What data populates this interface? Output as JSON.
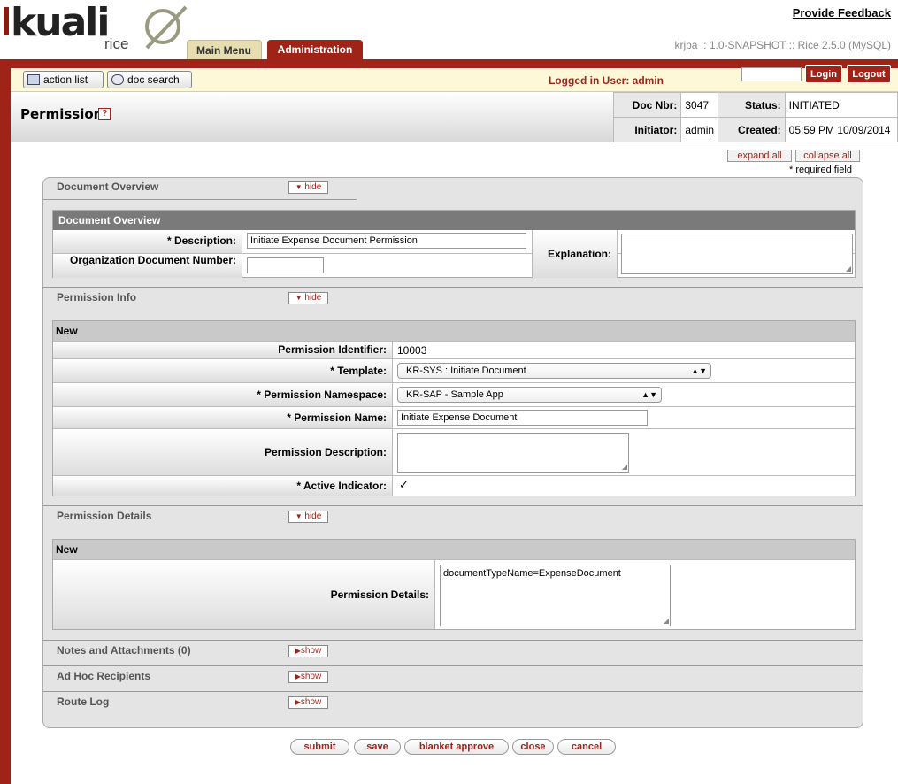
{
  "header": {
    "logo_text": "kuali",
    "logo_sub": "rice",
    "feedback_link": "Provide Feedback",
    "version": "krjpa :: 1.0-SNAPSHOT :: Rice 2.5.0 (MySQL)",
    "tabs": [
      {
        "label": "Main Menu"
      },
      {
        "label": "Administration"
      }
    ]
  },
  "utility": {
    "action_list": "action list",
    "doc_search": "doc search",
    "logged_in": "Logged in User: admin",
    "login_value": "",
    "login_label": "Login",
    "logout_label": "Logout"
  },
  "doc": {
    "title": "Permission",
    "help": "?",
    "doc_nbr_label": "Doc Nbr:",
    "doc_nbr": "3047",
    "status_label": "Status:",
    "status": "INITIATED",
    "initiator_label": "Initiator:",
    "initiator": "admin",
    "created_label": "Created:",
    "created": "05:59 PM 10/09/2014"
  },
  "controls": {
    "expand_all": "expand all",
    "collapse_all": "collapse all",
    "required_note": "* required field"
  },
  "overview": {
    "tab_title": "Document Overview",
    "toggle": "hide",
    "header": "Document Overview",
    "description_label": "*  Description:",
    "description_value": "Initiate Expense Document Permission",
    "org_doc_label": "Organization Document Number:",
    "org_doc_value": "",
    "explanation_label": "Explanation:",
    "explanation_value": ""
  },
  "permission_info": {
    "tab_title": "Permission Info",
    "toggle": "hide",
    "subheader": "New",
    "identifier_label": "Permission Identifier:",
    "identifier_value": "10003",
    "template_label": "*  Template:",
    "template_value": "KR-SYS : Initiate Document",
    "namespace_label": "*  Permission Namespace:",
    "namespace_value": "KR-SAP - Sample App",
    "name_label": "*  Permission Name:",
    "name_value": "Initiate Expense Document",
    "description_label": "Permission Description:",
    "description_value": "",
    "active_label": "*  Active Indicator:",
    "active_checked": true
  },
  "permission_details": {
    "tab_title": "Permission Details",
    "toggle": "hide",
    "subheader": "New",
    "details_label": "Permission Details:",
    "details_value": "documentTypeName=ExpenseDocument"
  },
  "collapsed_tabs": [
    {
      "title": "Notes and Attachments (0)",
      "toggle": "show"
    },
    {
      "title": "Ad Hoc Recipients",
      "toggle": "show"
    },
    {
      "title": "Route Log",
      "toggle": "show"
    }
  ],
  "buttons": {
    "submit": "submit",
    "save": "save",
    "blanket_approve": "blanket approve",
    "close": "close",
    "cancel": "cancel"
  },
  "colors": {
    "brand_red": "#a02318",
    "tab_gold": "#e6ddb0"
  }
}
